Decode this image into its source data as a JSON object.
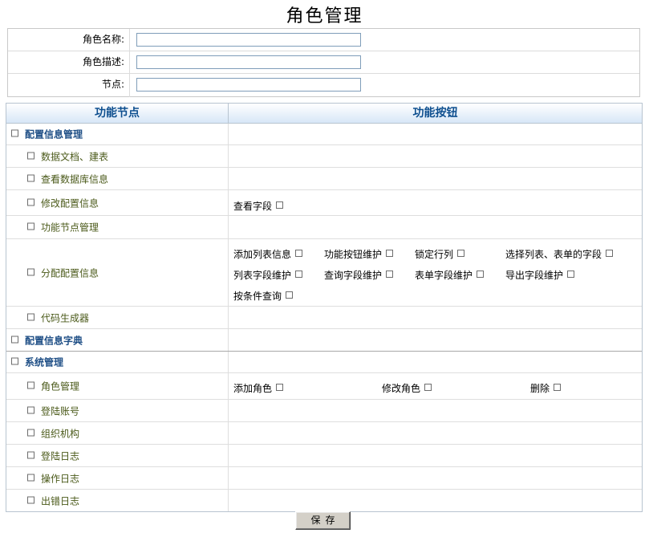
{
  "page_title": "角色管理",
  "form": {
    "role_name_label": "角色名称:",
    "role_name_value": "",
    "role_desc_label": "角色描述:",
    "role_desc_value": "",
    "node_label": "节点:",
    "node_value": ""
  },
  "table": {
    "col_nodes": "功能节点",
    "col_buttons": "功能按钮",
    "nodes": [
      {
        "label": "配置信息管理",
        "level": 1
      },
      {
        "label": "数据文档、建表",
        "level": 2
      },
      {
        "label": "查看数据库信息",
        "level": 2
      },
      {
        "label": "修改配置信息",
        "level": 2,
        "buttons": [
          "查看字段"
        ]
      },
      {
        "label": "功能节点管理",
        "level": 2
      },
      {
        "label": "分配配置信息",
        "level": 2,
        "buttons": [
          "添加列表信息",
          "功能按钮维护",
          "锁定行列",
          "选择列表、表单的字段",
          "列表字段维护",
          "查询字段维护",
          "表单字段维护",
          "导出字段维护",
          "按条件查询"
        ]
      },
      {
        "label": "代码生成器",
        "level": 2
      },
      {
        "label": "配置信息字典",
        "level": 1
      },
      {
        "label": "系统管理",
        "level": 1
      },
      {
        "label": "角色管理",
        "level": 2,
        "buttons": [
          "添加角色",
          "修改角色",
          "删除"
        ]
      },
      {
        "label": "登陆账号",
        "level": 2
      },
      {
        "label": "组织机构",
        "level": 2
      },
      {
        "label": "登陆日志",
        "level": 2
      },
      {
        "label": "操作日志",
        "level": 2
      },
      {
        "label": "出错日志",
        "level": 2
      }
    ]
  },
  "save_label": "保存"
}
